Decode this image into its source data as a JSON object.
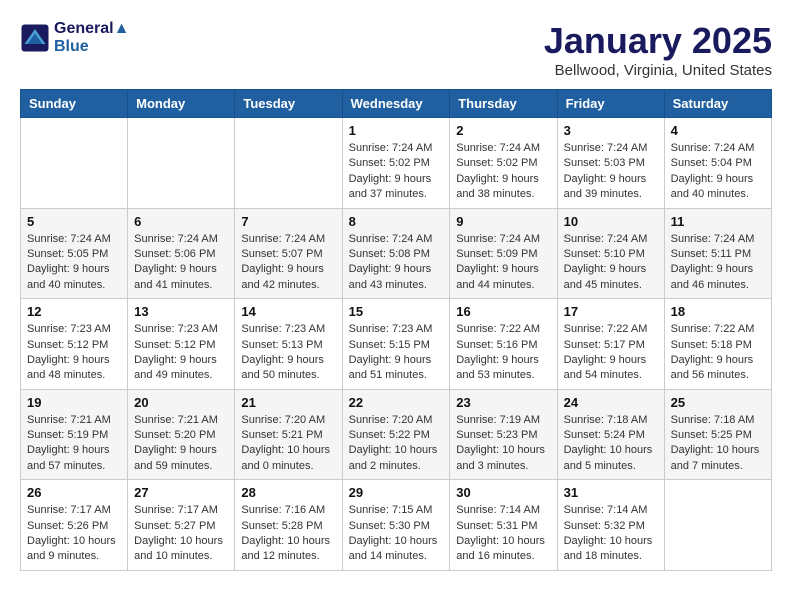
{
  "header": {
    "logo_line1": "General",
    "logo_line2": "Blue",
    "month_title": "January 2025",
    "location": "Bellwood, Virginia, United States"
  },
  "weekdays": [
    "Sunday",
    "Monday",
    "Tuesday",
    "Wednesday",
    "Thursday",
    "Friday",
    "Saturday"
  ],
  "weeks": [
    [
      {
        "day": "",
        "info": ""
      },
      {
        "day": "",
        "info": ""
      },
      {
        "day": "",
        "info": ""
      },
      {
        "day": "1",
        "info": "Sunrise: 7:24 AM\nSunset: 5:02 PM\nDaylight: 9 hours\nand 37 minutes."
      },
      {
        "day": "2",
        "info": "Sunrise: 7:24 AM\nSunset: 5:02 PM\nDaylight: 9 hours\nand 38 minutes."
      },
      {
        "day": "3",
        "info": "Sunrise: 7:24 AM\nSunset: 5:03 PM\nDaylight: 9 hours\nand 39 minutes."
      },
      {
        "day": "4",
        "info": "Sunrise: 7:24 AM\nSunset: 5:04 PM\nDaylight: 9 hours\nand 40 minutes."
      }
    ],
    [
      {
        "day": "5",
        "info": "Sunrise: 7:24 AM\nSunset: 5:05 PM\nDaylight: 9 hours\nand 40 minutes."
      },
      {
        "day": "6",
        "info": "Sunrise: 7:24 AM\nSunset: 5:06 PM\nDaylight: 9 hours\nand 41 minutes."
      },
      {
        "day": "7",
        "info": "Sunrise: 7:24 AM\nSunset: 5:07 PM\nDaylight: 9 hours\nand 42 minutes."
      },
      {
        "day": "8",
        "info": "Sunrise: 7:24 AM\nSunset: 5:08 PM\nDaylight: 9 hours\nand 43 minutes."
      },
      {
        "day": "9",
        "info": "Sunrise: 7:24 AM\nSunset: 5:09 PM\nDaylight: 9 hours\nand 44 minutes."
      },
      {
        "day": "10",
        "info": "Sunrise: 7:24 AM\nSunset: 5:10 PM\nDaylight: 9 hours\nand 45 minutes."
      },
      {
        "day": "11",
        "info": "Sunrise: 7:24 AM\nSunset: 5:11 PM\nDaylight: 9 hours\nand 46 minutes."
      }
    ],
    [
      {
        "day": "12",
        "info": "Sunrise: 7:23 AM\nSunset: 5:12 PM\nDaylight: 9 hours\nand 48 minutes."
      },
      {
        "day": "13",
        "info": "Sunrise: 7:23 AM\nSunset: 5:12 PM\nDaylight: 9 hours\nand 49 minutes."
      },
      {
        "day": "14",
        "info": "Sunrise: 7:23 AM\nSunset: 5:13 PM\nDaylight: 9 hours\nand 50 minutes."
      },
      {
        "day": "15",
        "info": "Sunrise: 7:23 AM\nSunset: 5:15 PM\nDaylight: 9 hours\nand 51 minutes."
      },
      {
        "day": "16",
        "info": "Sunrise: 7:22 AM\nSunset: 5:16 PM\nDaylight: 9 hours\nand 53 minutes."
      },
      {
        "day": "17",
        "info": "Sunrise: 7:22 AM\nSunset: 5:17 PM\nDaylight: 9 hours\nand 54 minutes."
      },
      {
        "day": "18",
        "info": "Sunrise: 7:22 AM\nSunset: 5:18 PM\nDaylight: 9 hours\nand 56 minutes."
      }
    ],
    [
      {
        "day": "19",
        "info": "Sunrise: 7:21 AM\nSunset: 5:19 PM\nDaylight: 9 hours\nand 57 minutes."
      },
      {
        "day": "20",
        "info": "Sunrise: 7:21 AM\nSunset: 5:20 PM\nDaylight: 9 hours\nand 59 minutes."
      },
      {
        "day": "21",
        "info": "Sunrise: 7:20 AM\nSunset: 5:21 PM\nDaylight: 10 hours\nand 0 minutes."
      },
      {
        "day": "22",
        "info": "Sunrise: 7:20 AM\nSunset: 5:22 PM\nDaylight: 10 hours\nand 2 minutes."
      },
      {
        "day": "23",
        "info": "Sunrise: 7:19 AM\nSunset: 5:23 PM\nDaylight: 10 hours\nand 3 minutes."
      },
      {
        "day": "24",
        "info": "Sunrise: 7:18 AM\nSunset: 5:24 PM\nDaylight: 10 hours\nand 5 minutes."
      },
      {
        "day": "25",
        "info": "Sunrise: 7:18 AM\nSunset: 5:25 PM\nDaylight: 10 hours\nand 7 minutes."
      }
    ],
    [
      {
        "day": "26",
        "info": "Sunrise: 7:17 AM\nSunset: 5:26 PM\nDaylight: 10 hours\nand 9 minutes."
      },
      {
        "day": "27",
        "info": "Sunrise: 7:17 AM\nSunset: 5:27 PM\nDaylight: 10 hours\nand 10 minutes."
      },
      {
        "day": "28",
        "info": "Sunrise: 7:16 AM\nSunset: 5:28 PM\nDaylight: 10 hours\nand 12 minutes."
      },
      {
        "day": "29",
        "info": "Sunrise: 7:15 AM\nSunset: 5:30 PM\nDaylight: 10 hours\nand 14 minutes."
      },
      {
        "day": "30",
        "info": "Sunrise: 7:14 AM\nSunset: 5:31 PM\nDaylight: 10 hours\nand 16 minutes."
      },
      {
        "day": "31",
        "info": "Sunrise: 7:14 AM\nSunset: 5:32 PM\nDaylight: 10 hours\nand 18 minutes."
      },
      {
        "day": "",
        "info": ""
      }
    ]
  ]
}
